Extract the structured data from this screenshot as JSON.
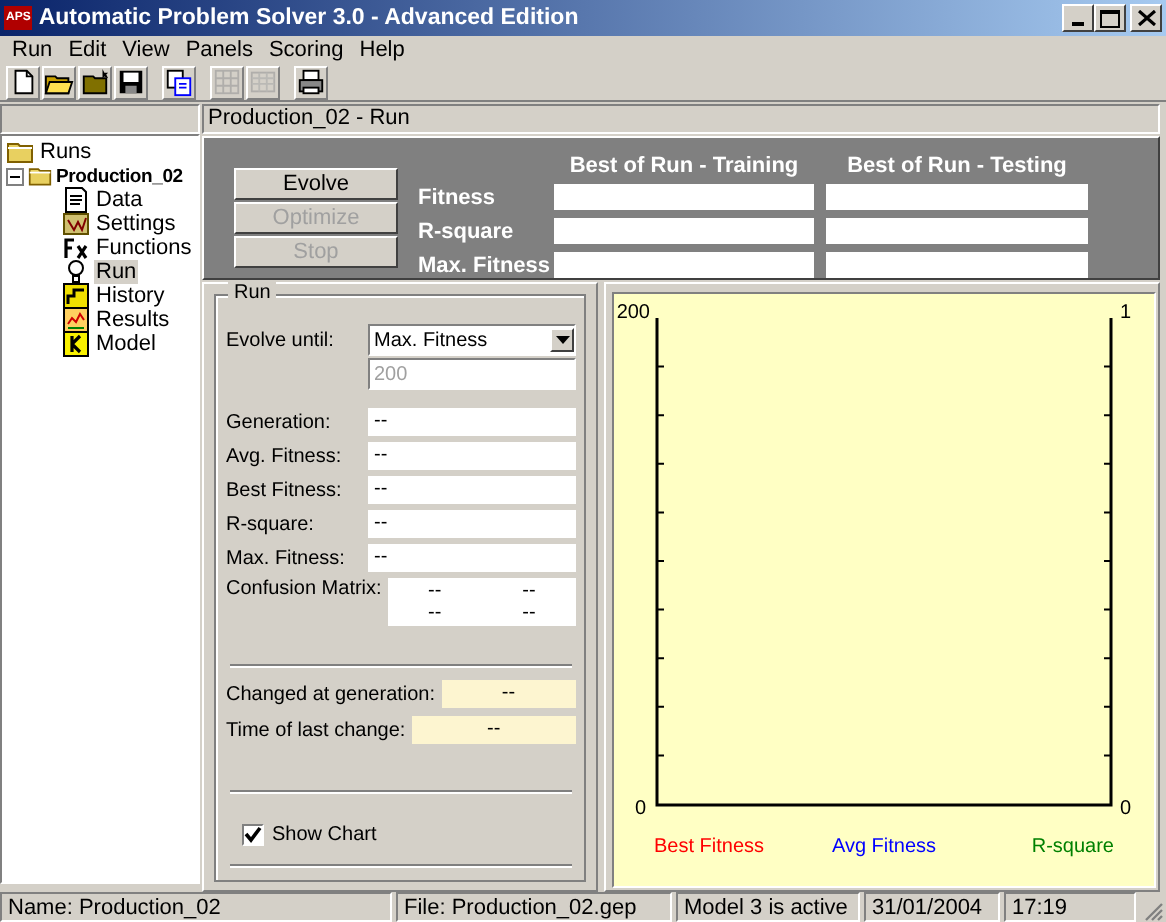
{
  "window": {
    "title": "Automatic Problem Solver 3.0 - Advanced Edition",
    "app_badge": "APS"
  },
  "menu": [
    "Run",
    "Edit",
    "View",
    "Panels",
    "Scoring",
    "Help"
  ],
  "toolbar": [
    {
      "disabled": false
    },
    {
      "disabled": false
    },
    {
      "disabled": false
    },
    {
      "disabled": false
    },
    {
      "disabled": false
    },
    {
      "disabled": true
    },
    {
      "disabled": true
    },
    {
      "disabled": false
    }
  ],
  "tree": {
    "label": "Runs",
    "selected": false,
    "children": [
      {
        "label": "Production_02",
        "selected": false,
        "expanded": true,
        "children": [
          {
            "label": "Data",
            "selected": false
          },
          {
            "label": "Settings",
            "selected": false
          },
          {
            "label": "Functions",
            "selected": false
          },
          {
            "label": "Run",
            "selected": true
          },
          {
            "label": "History",
            "selected": false
          },
          {
            "label": "Results",
            "selected": false
          },
          {
            "label": "Model",
            "selected": false
          }
        ]
      }
    ]
  },
  "page_header": "Production_02 - Run",
  "actions": [
    {
      "label": "Evolve",
      "disabled": false
    },
    {
      "label": "Optimize",
      "disabled": true
    },
    {
      "label": "Stop",
      "disabled": true
    }
  ],
  "results": {
    "columns": [
      "Best of Run - Training",
      "Best of Run - Testing"
    ],
    "rows": [
      {
        "label": "Fitness"
      },
      {
        "label": "R-square"
      },
      {
        "label": "Max. Fitness"
      }
    ]
  },
  "run": {
    "title": "Run",
    "evolve_until": {
      "label": "Evolve until:",
      "value": "Max. Fitness"
    },
    "limit": {
      "value": "200",
      "disabled": true
    },
    "stats": [
      {
        "label": "Generation:",
        "value": "--"
      },
      {
        "label": "Avg. Fitness:",
        "value": "--"
      },
      {
        "label": "Best Fitness:",
        "value": "--"
      },
      {
        "label": "R-square:",
        "value": "--"
      },
      {
        "label": "Max. Fitness:",
        "value": "--"
      }
    ],
    "confusion_matrix": {
      "label": "Confusion Matrix:",
      "cells": [
        [
          "--",
          "--"
        ],
        [
          "--",
          "--"
        ]
      ]
    },
    "changes": [
      {
        "label": "Changed at generation:",
        "value": "--"
      },
      {
        "label": "Time of last change:",
        "value": "--"
      }
    ],
    "show_chart": {
      "label": "Show Chart",
      "checked": true
    }
  },
  "chart": {
    "left_axis": {
      "max": "200",
      "min": "0"
    },
    "right_axis": {
      "max": "1",
      "min": "0"
    },
    "legend": [
      {
        "label": "Best Fitness",
        "color": "#ff0000"
      },
      {
        "label": "Avg Fitness",
        "color": "#0000ff"
      },
      {
        "label": "R-square",
        "color": "#008000"
      }
    ]
  },
  "status_bar": [
    "Name: Production_02",
    "File: Production_02.gep",
    "Model 3 is active",
    "31/01/2004",
    "17:19"
  ]
}
